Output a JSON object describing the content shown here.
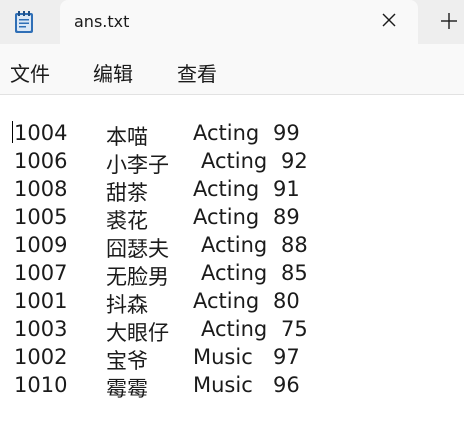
{
  "tab": {
    "title": "ans.txt"
  },
  "menu": {
    "file": "文件",
    "edit": "编辑",
    "view": "查看"
  },
  "lines": [
    {
      "id": "1004",
      "name": "本喵",
      "dept": "Acting",
      "score": "99"
    },
    {
      "id": "1006",
      "name": "小李子",
      "dept": "Acting",
      "score": "92"
    },
    {
      "id": "1008",
      "name": "甜茶",
      "dept": "Acting",
      "score": "91"
    },
    {
      "id": "1005",
      "name": "裘花",
      "dept": "Acting",
      "score": "89"
    },
    {
      "id": "1009",
      "name": "囧瑟夫",
      "dept": "Acting",
      "score": "88"
    },
    {
      "id": "1007",
      "name": "无脸男",
      "dept": "Acting",
      "score": "85"
    },
    {
      "id": "1001",
      "name": "抖森",
      "dept": "Acting",
      "score": "80"
    },
    {
      "id": "1003",
      "name": "大眼仔",
      "dept": "Acting",
      "score": "75"
    },
    {
      "id": "1002",
      "name": "宝爷",
      "dept": "Music",
      "score": "97"
    },
    {
      "id": "1010",
      "name": "霉霉",
      "dept": "Music",
      "score": "96"
    }
  ]
}
